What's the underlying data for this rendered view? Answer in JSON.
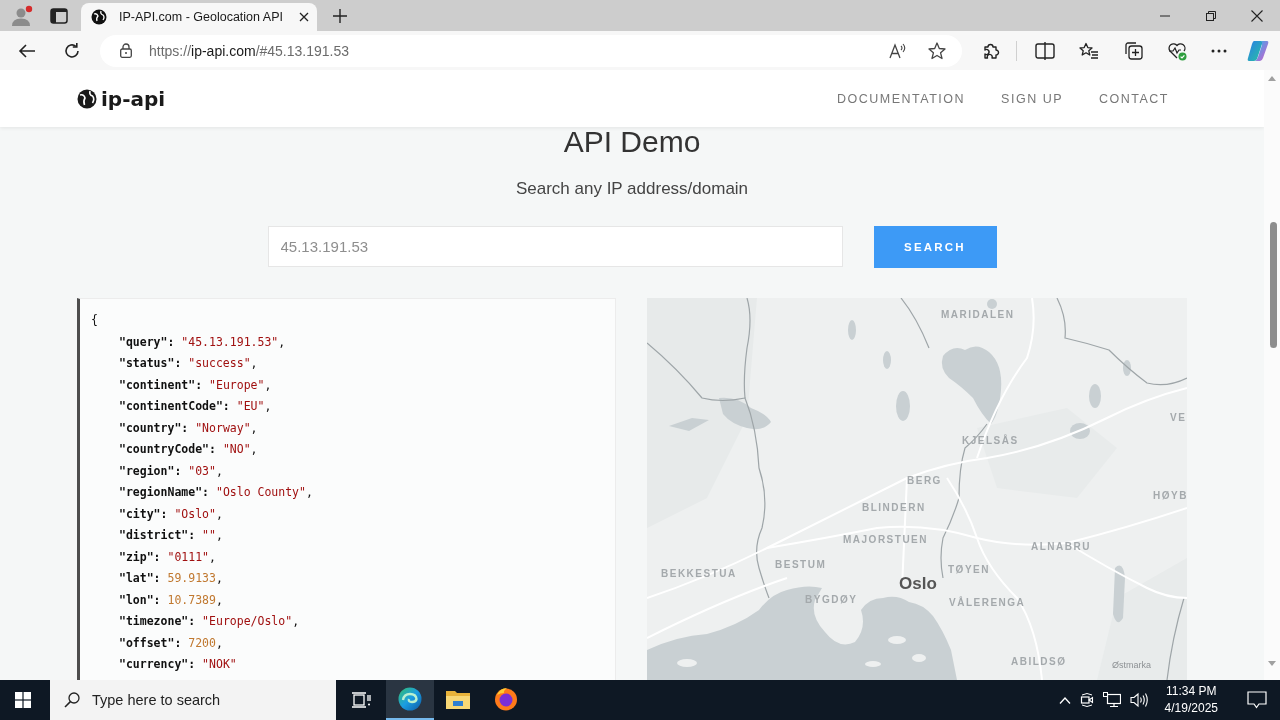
{
  "browser": {
    "tab": {
      "title": "IP-API.com - Geolocation API",
      "selected": true
    },
    "address": {
      "scheme": "https://",
      "host": "ip-api.com",
      "path": "/#45.13.191.53"
    }
  },
  "header": {
    "logo": "ip-api",
    "nav": [
      "DOCUMENTATION",
      "SIGN UP",
      "CONTACT"
    ]
  },
  "demo": {
    "title": "API Demo",
    "subtitle": "Search any IP address/domain",
    "search": {
      "placeholder": "45.13.191.53",
      "button": "SEARCH"
    }
  },
  "response": {
    "open": "{",
    "lines": [
      {
        "key": "\"query\":",
        "value": "\"45.13.191.53\"",
        "kind": "string",
        "end": ","
      },
      {
        "key": "\"status\":",
        "value": "\"success\"",
        "kind": "string",
        "end": ","
      },
      {
        "key": "\"continent\":",
        "value": "\"Europe\"",
        "kind": "string",
        "end": ","
      },
      {
        "key": "\"continentCode\":",
        "value": "\"EU\"",
        "kind": "string",
        "end": ","
      },
      {
        "key": "\"country\":",
        "value": "\"Norway\"",
        "kind": "string",
        "end": ","
      },
      {
        "key": "\"countryCode\":",
        "value": "\"NO\"",
        "kind": "string",
        "end": ","
      },
      {
        "key": "\"region\":",
        "value": "\"03\"",
        "kind": "string",
        "end": ","
      },
      {
        "key": "\"regionName\":",
        "value": "\"Oslo County\"",
        "kind": "string",
        "end": ","
      },
      {
        "key": "\"city\":",
        "value": "\"Oslo\"",
        "kind": "string",
        "end": ","
      },
      {
        "key": "\"district\":",
        "value": "\"\"",
        "kind": "string",
        "end": ","
      },
      {
        "key": "\"zip\":",
        "value": "\"0111\"",
        "kind": "string",
        "end": ","
      },
      {
        "key": "\"lat\":",
        "value": "59.9133",
        "kind": "number",
        "end": ","
      },
      {
        "key": "\"lon\":",
        "value": "10.7389",
        "kind": "number",
        "end": ","
      },
      {
        "key": "\"timezone\":",
        "value": "\"Europe/Oslo\"",
        "kind": "string",
        "end": ","
      },
      {
        "key": "\"offset\":",
        "value": "7200",
        "kind": "number",
        "end": ","
      },
      {
        "key": "\"currency\":",
        "value": "\"NOK\"",
        "kind": "string"
      }
    ]
  },
  "map": {
    "labels": [
      {
        "text": "MARIDALEN",
        "kind": "area"
      },
      {
        "text": "VE",
        "kind": "area"
      },
      {
        "text": "KJELSÅS",
        "kind": "area"
      },
      {
        "text": "BERG",
        "kind": "area"
      },
      {
        "text": "HØYB",
        "kind": "area"
      },
      {
        "text": "BLINDERN",
        "kind": "area"
      },
      {
        "text": "MAJORSTUEN",
        "kind": "area"
      },
      {
        "text": "ALNABRU",
        "kind": "area"
      },
      {
        "text": "BESTUM",
        "kind": "area"
      },
      {
        "text": "TØYEN",
        "kind": "area"
      },
      {
        "text": "BEKKESTUA",
        "kind": "area"
      },
      {
        "text": "Oslo",
        "kind": "city"
      },
      {
        "text": "BYGDØY",
        "kind": "area"
      },
      {
        "text": "VÅLERENGA",
        "kind": "area"
      },
      {
        "text": "ABILDSØ",
        "kind": "area"
      },
      {
        "text": "Østmarka",
        "kind": "place"
      }
    ]
  },
  "taskbar": {
    "search": {
      "placeholder": "Type here to search"
    },
    "apps": [
      {
        "kind": "edge",
        "selected": true
      },
      {
        "kind": "explorer",
        "selected": false
      },
      {
        "kind": "firefox",
        "selected": false
      }
    ],
    "clock": {
      "time": "11:34 PM",
      "date": "4/19/2025"
    }
  }
}
